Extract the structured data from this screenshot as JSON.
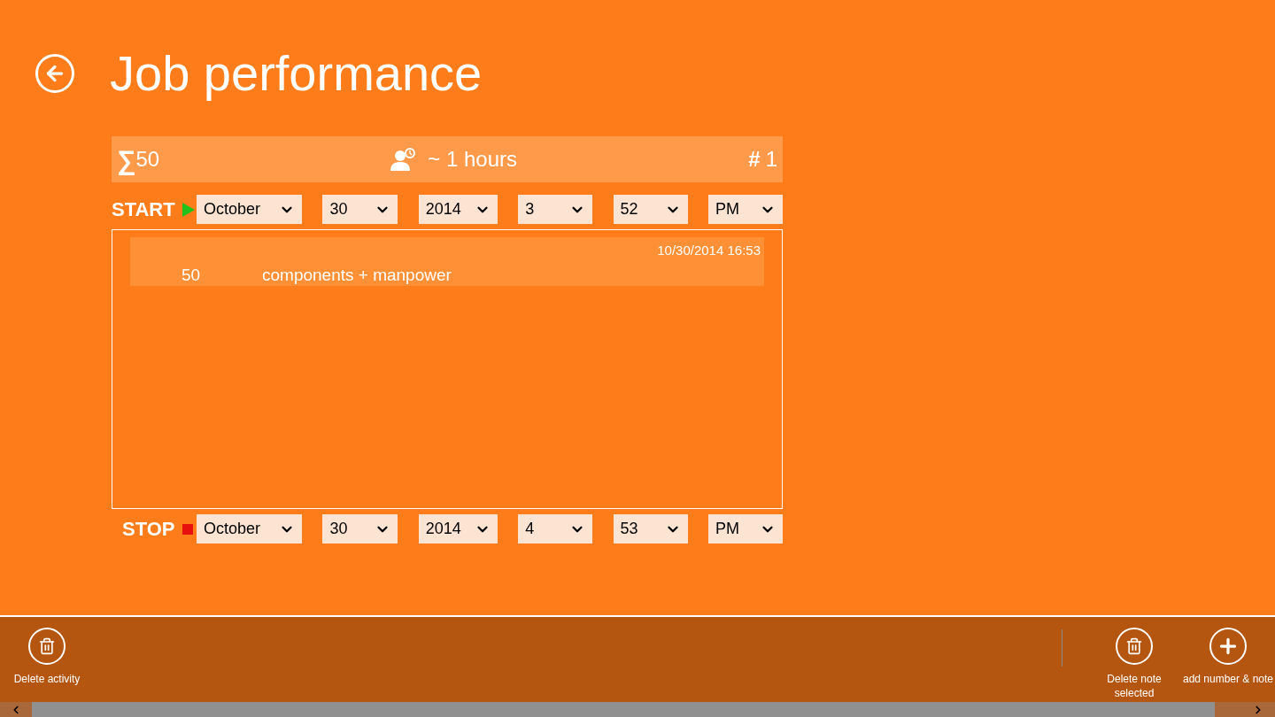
{
  "title": "Job performance",
  "summary": {
    "total": "50",
    "duration": "~ 1 hours",
    "count_symbol": "#",
    "count": "1",
    "sum_symbol": "∑"
  },
  "start": {
    "label": "START",
    "fields": [
      "October",
      "30",
      "2014",
      "3",
      "52",
      "PM"
    ]
  },
  "notes": [
    {
      "timestamp": "10/30/2014 16:53",
      "number": "50",
      "text": "components + manpower",
      "selected": true
    }
  ],
  "stop": {
    "label": "STOP",
    "fields": [
      "October",
      "30",
      "2014",
      "4",
      "53",
      "PM"
    ]
  },
  "app_bar": {
    "left": [
      {
        "label": "Delete activity",
        "kind": "delete"
      }
    ],
    "right": [
      {
        "label": "Delete note selected",
        "kind": "delete"
      },
      {
        "label": "add number & note",
        "kind": "add"
      }
    ]
  }
}
